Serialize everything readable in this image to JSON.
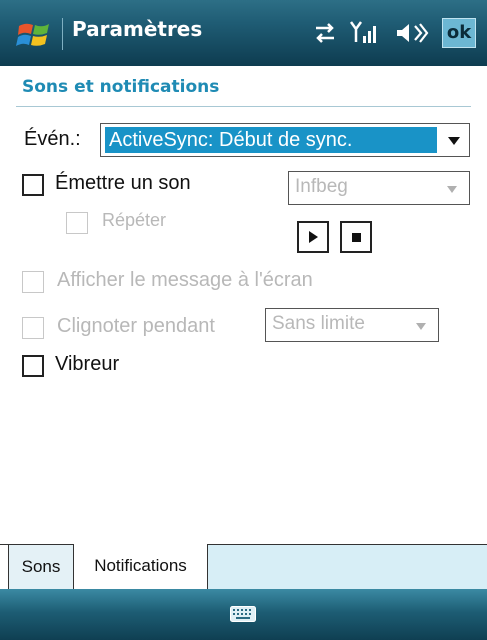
{
  "titlebar": {
    "title": "Paramètres",
    "ok_label": "ok",
    "icons": [
      "windows-start-icon",
      "connectivity-icon",
      "signal-strength-icon",
      "speaker-icon"
    ]
  },
  "section": {
    "title": "Sons et notifications"
  },
  "form": {
    "event_label": "Évén.:",
    "event_value": "ActiveSync: Début de sync.",
    "play_sound": {
      "label": "Émettre un son",
      "checked": false
    },
    "sound_value": "Infbeg",
    "repeat": {
      "label": "Répéter",
      "checked": false,
      "enabled": false
    },
    "show_message": {
      "label": "Afficher le message à l'écran",
      "checked": false,
      "enabled": false
    },
    "flash": {
      "label": "Clignoter pendant",
      "checked": false,
      "enabled": false
    },
    "flash_value": "Sans limite",
    "vibrate": {
      "label": "Vibreur",
      "checked": false
    }
  },
  "tabs": [
    {
      "label": "Sons",
      "active": false
    },
    {
      "label": "Notifications",
      "active": true
    }
  ],
  "bottombar": {
    "icon": "keyboard-icon"
  },
  "colors": {
    "titlebar": "#1f5c74",
    "accent": "#1f8bb4",
    "selection": "#1993c7",
    "ok_button": "#6cb7d3",
    "tab_bg": "#d7eef6"
  }
}
